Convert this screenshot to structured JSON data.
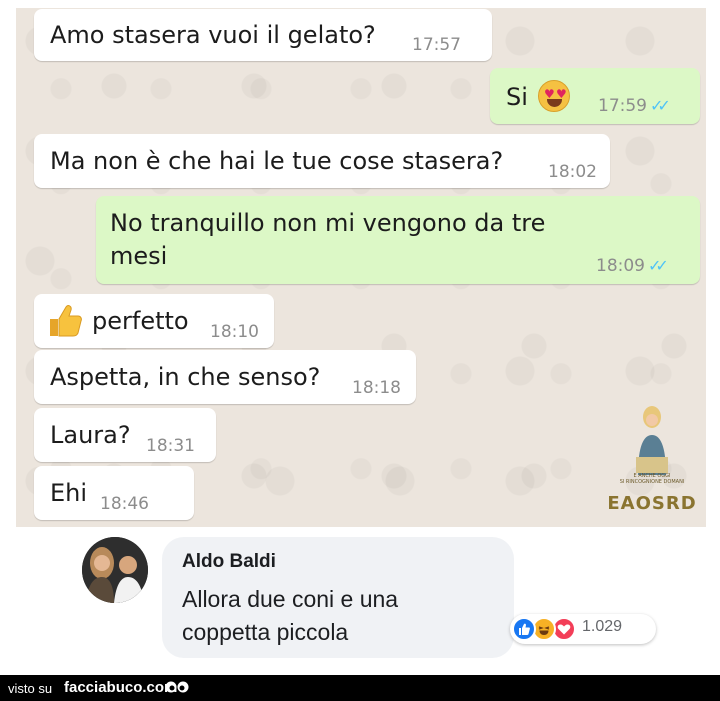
{
  "chat": {
    "messages": [
      {
        "side": "in",
        "text": "Amo stasera vuoi il gelato?",
        "time": "17:57"
      },
      {
        "side": "out",
        "text": "Si",
        "emoji": "heart-eyes-emoji",
        "time": "17:59",
        "read": true
      },
      {
        "side": "in",
        "text": "Ma non è che hai le tue cose stasera?",
        "time": "18:02"
      },
      {
        "side": "out",
        "text_line1": "No tranquillo non mi vengono da tre",
        "text_line2": "mesi",
        "time": "18:09",
        "read": true
      },
      {
        "side": "in",
        "emoji": "thumbs-up-emoji",
        "text": "perfetto",
        "time": "18:10"
      },
      {
        "side": "in",
        "text": "Aspetta, in che senso?",
        "time": "18:18"
      },
      {
        "side": "in",
        "text": "Laura?",
        "time": "18:31"
      },
      {
        "side": "in",
        "text": "Ehi",
        "time": "18:46"
      }
    ],
    "read_ticks": "✓✓"
  },
  "watermark": {
    "small_text_line1": "E ANCHE OGGI",
    "small_text_line2": "SI RINCOGNIONE DOMANI",
    "brand": "EAOSRD"
  },
  "comment": {
    "author": "Aldo Baldi",
    "text_line1": "Allora due coni e una",
    "text_line2": "coppetta piccola",
    "reaction_count": "1.029",
    "reactions": [
      "like-icon",
      "haha-icon",
      "love-icon"
    ]
  },
  "footer": {
    "visto_su": "visto su",
    "site": "facciabuco.com"
  },
  "colors": {
    "incoming_bubble": "#ffffff",
    "outgoing_bubble": "#dcf8c6",
    "chat_background": "#ece5dd",
    "read_ticks": "#4fc3f7",
    "like": "#1877f2",
    "love": "#f33e58",
    "haha": "#f7b125"
  }
}
